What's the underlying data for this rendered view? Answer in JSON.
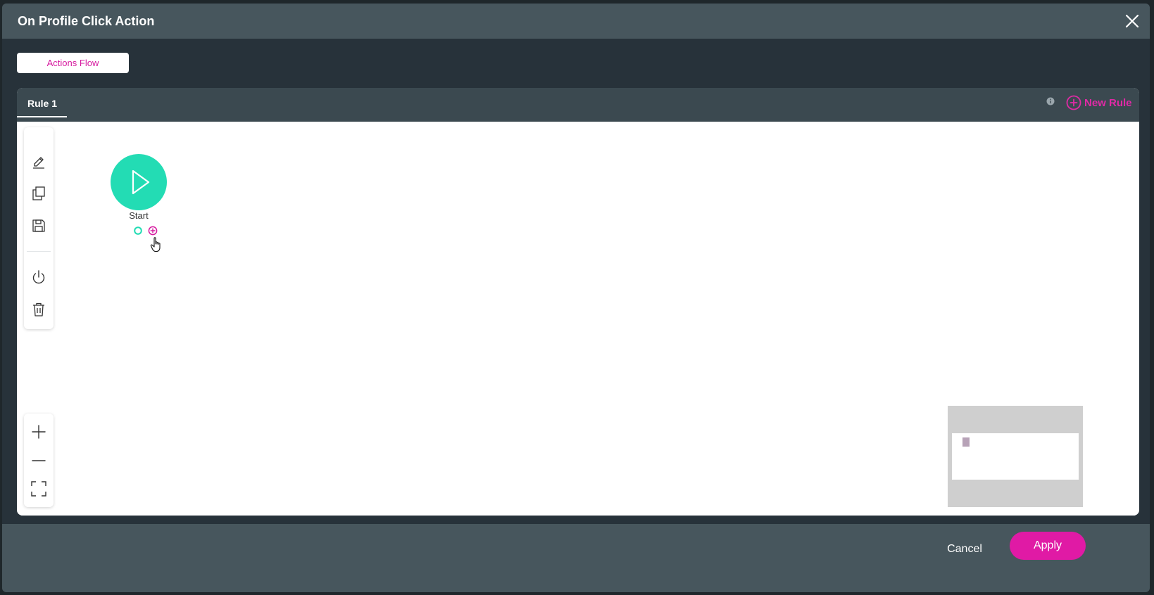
{
  "modal": {
    "title": "On Profile Click Action",
    "close_icon": "close-icon"
  },
  "tabs": {
    "actions_flow": "Actions Flow"
  },
  "rules": {
    "active_rule": "Rule 1",
    "info_icon": "info-icon",
    "new_rule_label": "New Rule",
    "new_rule_icon": "plus-circle-icon"
  },
  "toolbar": {
    "tools": [
      "edit-icon",
      "copy-icon",
      "save-icon",
      "power-icon",
      "trash-icon"
    ]
  },
  "zoom": {
    "tools": [
      "zoom-in-icon",
      "zoom-out-icon",
      "fit-screen-icon"
    ]
  },
  "flow": {
    "start_node_label": "Start",
    "start_icon": "play-icon"
  },
  "footer": {
    "cancel_label": "Cancel",
    "apply_label": "Apply"
  },
  "colors": {
    "accent": "#e01aa5",
    "start_node": "#23dcb4",
    "header": "#47565d",
    "panel_dark": "#27323a"
  }
}
